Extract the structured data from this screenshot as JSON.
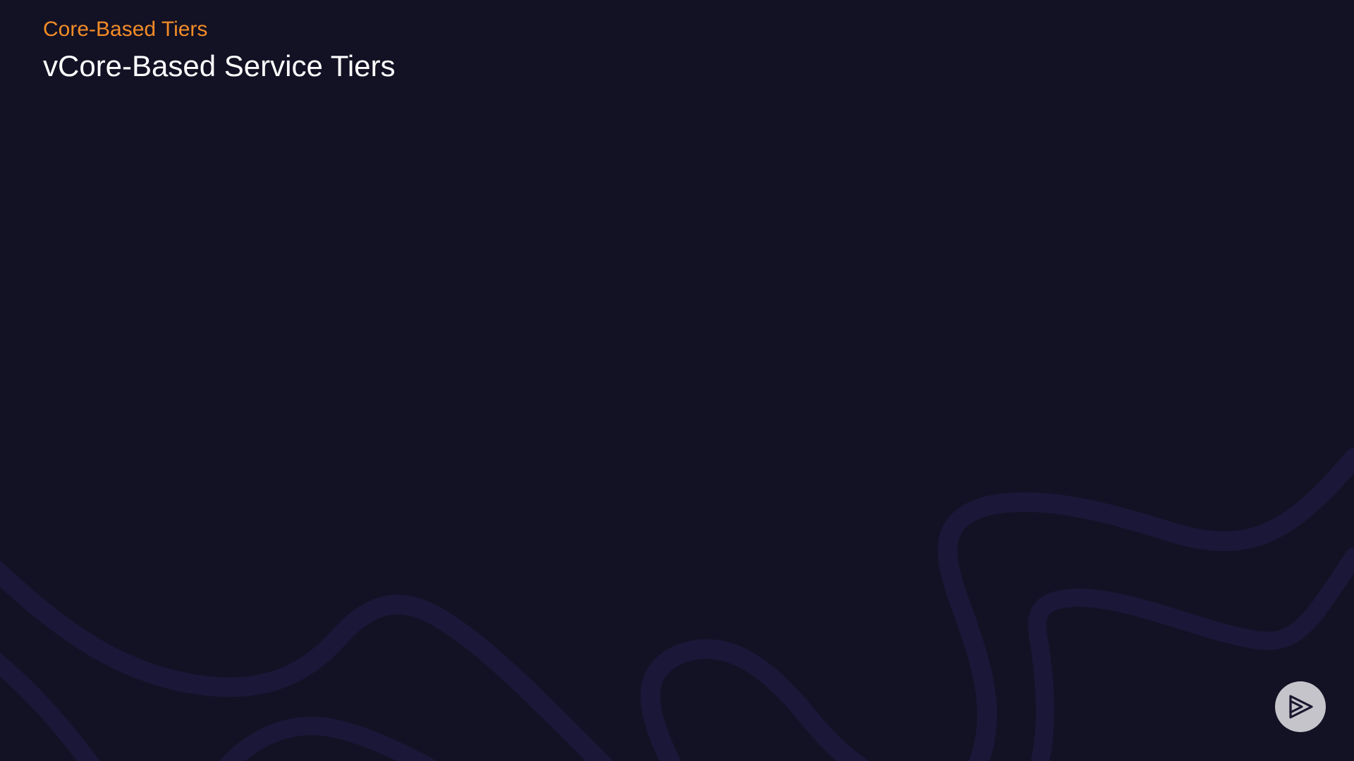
{
  "slide": {
    "eyebrow": "Core-Based Tiers",
    "title": "vCore-Based Service Tiers"
  },
  "logo": {
    "icon": "play-logo-icon"
  },
  "colors": {
    "background": "#131124",
    "eyebrow": "#f28c28",
    "title": "#ffffff",
    "waves": "#1b1738",
    "logo_bg": "#c4c4ca",
    "logo_fg": "#1a1730"
  }
}
